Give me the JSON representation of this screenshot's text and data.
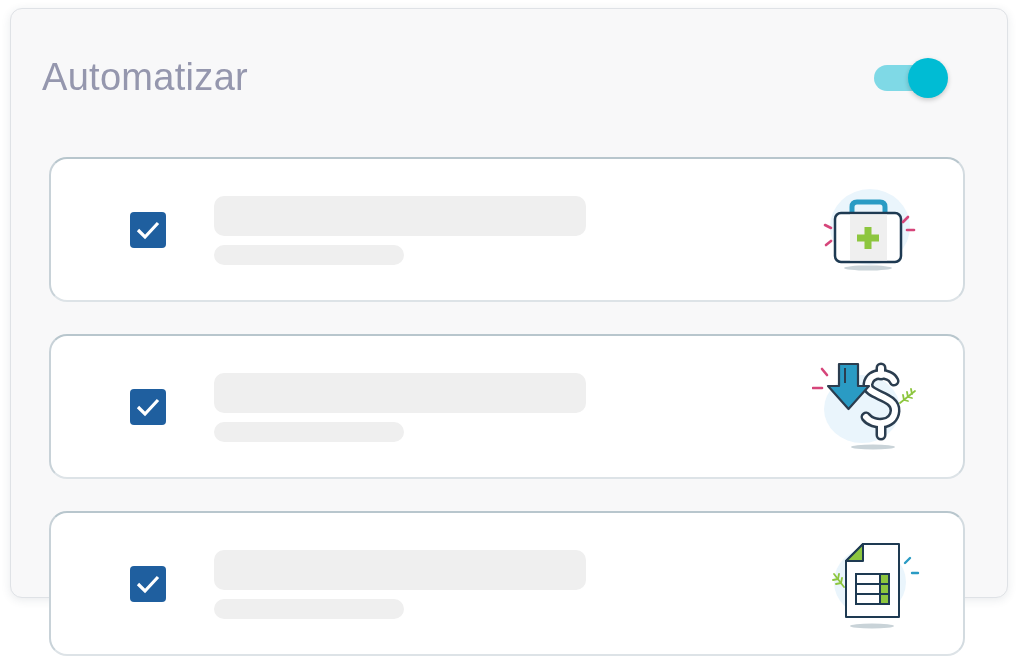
{
  "title": "Automatizar",
  "toggle": {
    "on": true
  },
  "items": [
    {
      "checked": true,
      "kind": "first_aid_kit"
    },
    {
      "checked": true,
      "kind": "dollar_arrow"
    },
    {
      "checked": true,
      "kind": "spreadsheet"
    }
  ]
}
